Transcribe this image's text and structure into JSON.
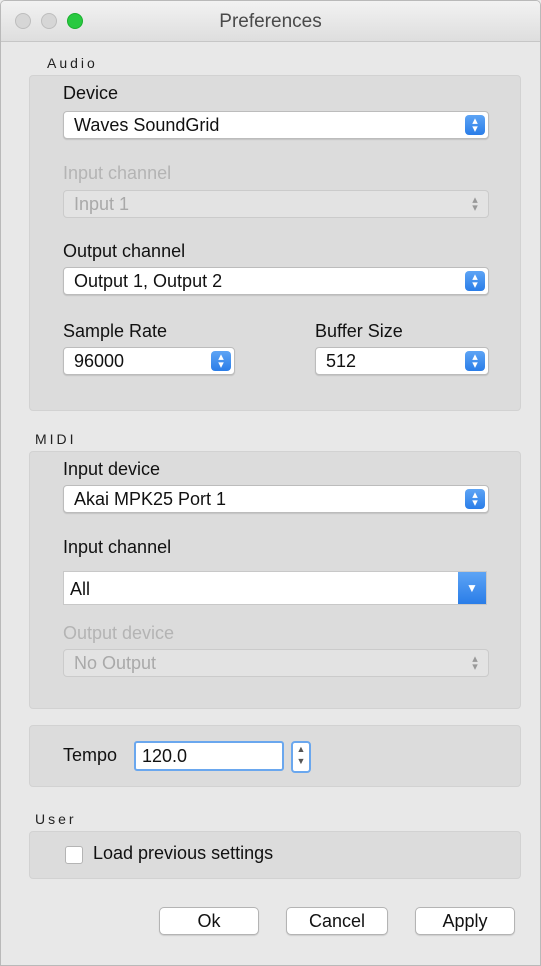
{
  "window": {
    "title": "Preferences"
  },
  "audio": {
    "section_label": "Audio",
    "device_label": "Device",
    "device_value": "Waves SoundGrid",
    "input_channel_label": "Input channel",
    "input_channel_value": "Input 1",
    "output_channel_label": "Output channel",
    "output_channel_value": "Output 1, Output 2",
    "sample_rate_label": "Sample Rate",
    "sample_rate_value": "96000",
    "buffer_size_label": "Buffer Size",
    "buffer_size_value": "512"
  },
  "midi": {
    "section_label": "MIDI",
    "input_device_label": "Input device",
    "input_device_value": "Akai MPK25 Port 1",
    "input_channel_label": "Input channel",
    "input_channel_value": "All",
    "output_device_label": "Output device",
    "output_device_value": "No Output"
  },
  "tempo": {
    "label": "Tempo",
    "value": "120.0"
  },
  "user": {
    "section_label": "User",
    "load_previous_label": "Load previous settings",
    "load_previous_checked": false
  },
  "buttons": {
    "ok": "Ok",
    "cancel": "Cancel",
    "apply": "Apply"
  },
  "icons": {
    "popup_arrows": "updown-chevron-icon",
    "combo_arrow": "chevron-down-icon",
    "stepper": "stepper-icon"
  },
  "colors": {
    "accent": "#2a7de8",
    "close_light": "#d6d6d6",
    "zoom_light": "#28c940"
  }
}
